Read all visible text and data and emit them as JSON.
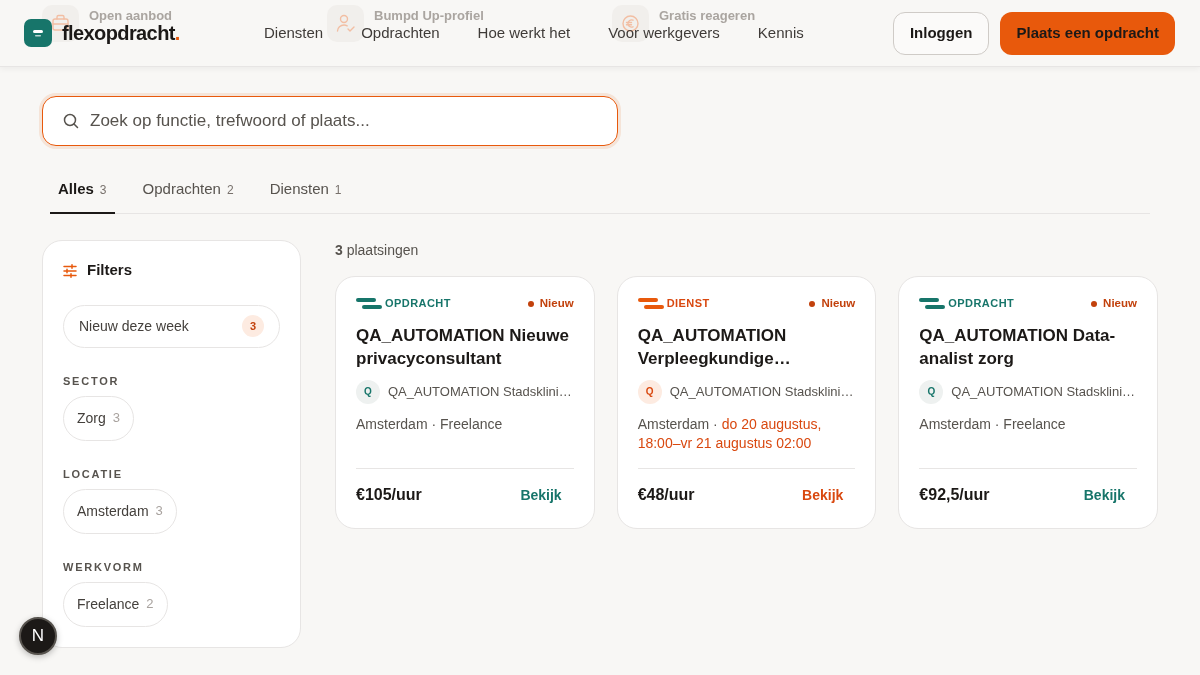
{
  "header": {
    "logo": {
      "name": "flexopdracht",
      "accent": "."
    },
    "promo_strip": [
      {
        "title": "Open aanbod"
      },
      {
        "title": "Bumpd Up-profiel"
      },
      {
        "title": "Gratis reageren"
      }
    ],
    "nav": [
      "Diensten",
      "Opdrachten",
      "Hoe werkt het",
      "Voor werkgevers",
      "Kennis"
    ],
    "login_button": "Inloggen",
    "cta_button": "Plaats een opdracht"
  },
  "search": {
    "placeholder": "Zoek op functie, trefwoord of plaats..."
  },
  "tabs": [
    {
      "label": "Alles",
      "count": "3",
      "selected": true
    },
    {
      "label": "Opdrachten",
      "count": "2",
      "selected": false
    },
    {
      "label": "Diensten",
      "count": "1",
      "selected": false
    }
  ],
  "filters": {
    "title": "Filters",
    "quick_filter": {
      "label": "Nieuw deze week",
      "count": "3",
      "selected": false
    },
    "groups": [
      {
        "heading": "SECTOR",
        "options": [
          {
            "label": "Zorg",
            "count": "3",
            "selected": false
          }
        ]
      },
      {
        "heading": "LOCATIE",
        "options": [
          {
            "label": "Amsterdam",
            "count": "3",
            "selected": false
          }
        ]
      },
      {
        "heading": "WERKVORM",
        "options": [
          {
            "label": "Freelance",
            "count": "2",
            "selected": false
          }
        ]
      }
    ]
  },
  "results": {
    "summary": "**3** plaatsingen",
    "cards": [
      {
        "kind": "opdracht",
        "type_label": "OPDRACHT",
        "badge": "Nieuw",
        "title": "QA_AUTOMATION Nieuwe privacyconsultant",
        "avatar": "Q",
        "company": "QA_AUTOMATION Stadsklini…",
        "meta": "Amsterdam · Freelance",
        "price": "€105/uur",
        "link": "Bekijk"
      },
      {
        "kind": "dienst",
        "type_label": "DIENST",
        "badge": "Nieuw",
        "title": "QA_AUTOMATION Verpleegkundige…",
        "avatar": "Q",
        "company": "QA_AUTOMATION Stadsklini…",
        "meta": "Amsterdam ·",
        "schedule": "do 20 augustus, 18:00–vr 21 augustus 02:00",
        "price": "€48/uur",
        "link": "Bekijk"
      },
      {
        "kind": "opdracht",
        "type_label": "OPDRACHT",
        "badge": "Nieuw",
        "title": "QA_AUTOMATION Data-analist zorg",
        "avatar": "Q",
        "company": "QA_AUTOMATION Stadsklini…",
        "meta": "Amsterdam · Freelance",
        "price": "€92,5/uur",
        "link": "Bekijk"
      }
    ]
  },
  "dev_badge": {
    "label": "N"
  }
}
